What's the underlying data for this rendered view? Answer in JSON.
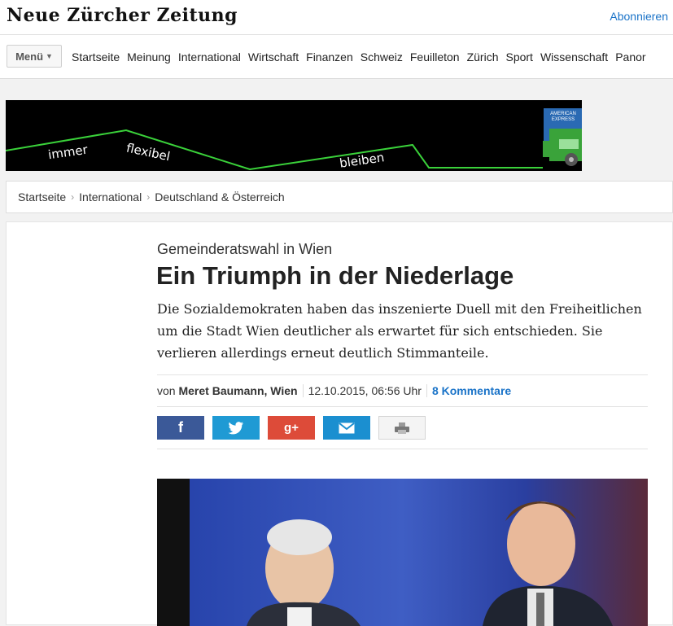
{
  "site": {
    "logo": "Neue Zürcher Zeitung",
    "subscribe": "Abonnieren"
  },
  "nav": {
    "menu_label": "Menü",
    "items": [
      "Startseite",
      "Meinung",
      "International",
      "Wirtschaft",
      "Finanzen",
      "Schweiz",
      "Feuilleton",
      "Zürich",
      "Sport",
      "Wissenschaft",
      "Panor"
    ]
  },
  "ad": {
    "words": [
      "immer",
      "flexibel",
      "bleiben"
    ],
    "brand": "AMERICAN EXPRESS",
    "colors": {
      "background": "#000000",
      "line": "#3ad13a"
    }
  },
  "breadcrumb": [
    "Startseite",
    "International",
    "Deutschland & Österreich"
  ],
  "article": {
    "kicker": "Gemeinderatswahl in Wien",
    "title": "Ein Triumph in der Niederlage",
    "lead": "Die Sozialdemokraten haben das inszenierte Duell mit den Freiheitlichen um die Stadt Wien deutlicher als erwartet für sich entschieden. Sie verlieren allerdings erneut deutlich Stimmanteile.",
    "by_prefix": "von",
    "author": "Meret Baumann, Wien",
    "datetime": "12.10.2015, 06:56 Uhr",
    "comments": "8 Kommentare"
  },
  "share": [
    {
      "name": "facebook",
      "glyph": "f",
      "icon": "facebook-icon",
      "color": "#3b5998"
    },
    {
      "name": "twitter",
      "glyph": "",
      "icon": "twitter-icon",
      "color": "#1f9ad4"
    },
    {
      "name": "googleplus",
      "glyph": "g+",
      "icon": "google-plus-icon",
      "color": "#dd4b39"
    },
    {
      "name": "email",
      "glyph": "",
      "icon": "mail-icon",
      "color": "#1b8fd0"
    },
    {
      "name": "print",
      "glyph": "",
      "icon": "print-icon",
      "color": "#f4f4f4"
    }
  ]
}
